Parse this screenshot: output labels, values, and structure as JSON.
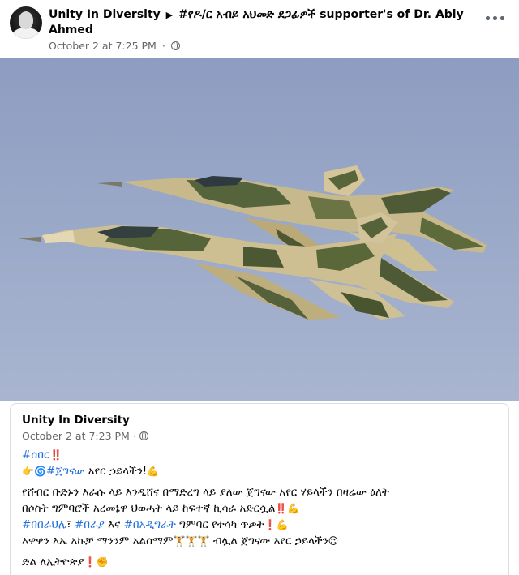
{
  "post": {
    "page_name": "Unity In Diversity",
    "group_name_part1": "#የዶ/ር አብይ አህመድ ደጋፊዎች supporter's of Dr. Abiy",
    "group_name_part2": "Ahmed",
    "timestamp": "October 2 at 7:25 PM",
    "separator": "·"
  },
  "shared_post": {
    "page_name": "Unity In Diversity",
    "timestamp": "October 2 at 7:23 PM",
    "separator": "·",
    "lines": {
      "l1_hashtag": "#ሰበር",
      "l1_emoji": "‼️",
      "l2_emoji1": "👉",
      "l2_emoji2": "🌀",
      "l2_hashtag": "#ጀግናው",
      "l2_text": " አየር ኃይላችን!",
      "l2_emoji3": "💪",
      "l3_text": "የሸብር ቡድኑን እራሱ ላይ እንዲሸና በማድረግ ላይ ያለው ጀግናው አየር ሃይላችን በዛሬው ዕለት",
      "l4_text": "በሶስት ግምባሮች አረመኔዋ ህወሓት ላይ ከፍተኛ ኪሳራ አድርሷል",
      "l4_emoji": "‼️💪",
      "l5_hashtag1": "#በበራህሌ",
      "l5_text1": "፣ ",
      "l5_hashtag2": "#በራያ",
      "l5_text2": " እና ",
      "l5_hashtag3": "#በአዲግራት",
      "l5_text3": " ግምባር የተሳካ ጥቃት",
      "l5_emoji": "❗💪",
      "l6_text1": "እዋዋን እኤ አኩቻ ማንንም አልሰማም",
      "l6_emoji1": "🏋🏋🏋",
      "l6_text2": "  ብሏል ጀግናው አየር ኃይላችን",
      "l6_emoji2": "😍",
      "l7_text": "ድል ለኢትዮጵያ",
      "l7_emoji": "❗✊"
    }
  },
  "colors": {
    "link": "#216fdb",
    "meta": "#65676b",
    "sky": "#9aa8c8"
  }
}
